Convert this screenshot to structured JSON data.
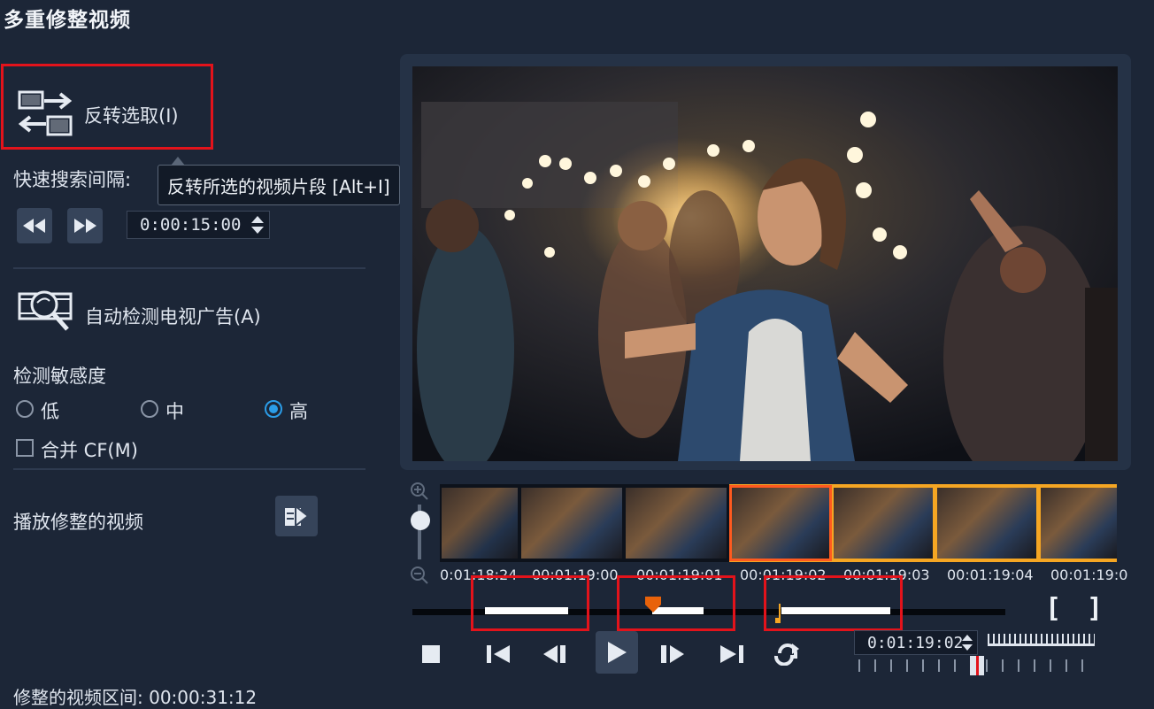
{
  "title": "多重修整视频",
  "invert_selection": {
    "label": "反转选取(I)",
    "tooltip": "反转所选的视频片段 [Alt+I]"
  },
  "quick_search": {
    "label": "快速搜索间隔:",
    "value": "0:00:15:00"
  },
  "auto_detect": {
    "label": "自动检测电视广告(A)"
  },
  "sensitivity": {
    "label": "检测敏感度",
    "options": [
      "低",
      "中",
      "高"
    ],
    "selected": "高"
  },
  "merge_cf": {
    "label": "合并 CF(M)",
    "checked": false
  },
  "play_trimmed": {
    "label": "播放修整的视频"
  },
  "trimmed_interval": {
    "label": "修整的视频区间: 00:00:31:12"
  },
  "timeline": {
    "timecodes": [
      "0:01:18:24",
      "00:01:19:00",
      "00:01:19:01",
      "00:01:19:02",
      "00:01:19:03",
      "00:01:19:04",
      "00:01:19:0"
    ]
  },
  "playhead_timecode": "0:01:19:02",
  "bracket_in": "[",
  "bracket_out": "]",
  "colors": {
    "accent": "#f5a623",
    "marker": "#e8620a",
    "highlight": "#e3131b",
    "radio": "#2b9de8"
  }
}
